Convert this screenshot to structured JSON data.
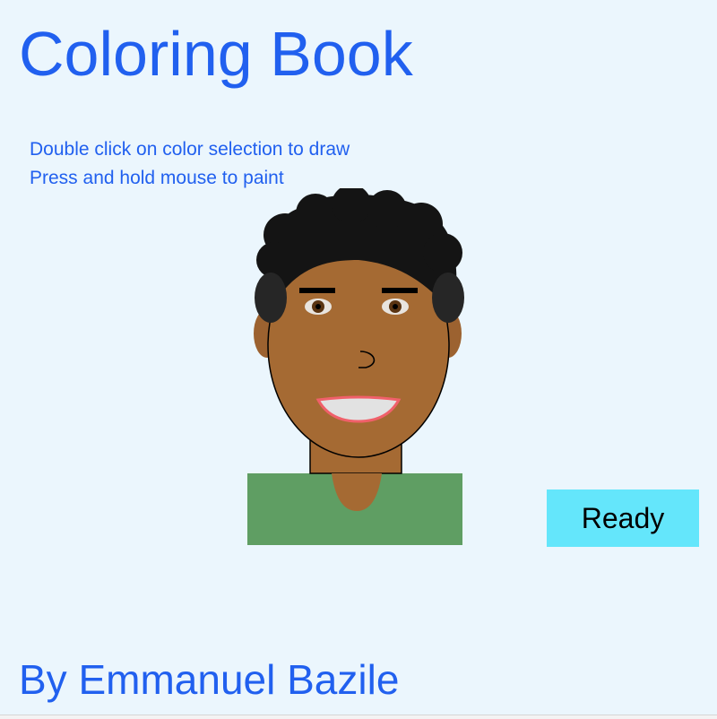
{
  "title": "Coloring Book",
  "instructions": {
    "line1": "Double click on color selection to draw",
    "line2": "Press and hold mouse to paint"
  },
  "ready_button": {
    "label": "Ready"
  },
  "author": "By Emmanuel Bazile",
  "colors": {
    "background": "#ebf6fd",
    "text_accent": "#2160ef",
    "ready_button": "#64e6fb",
    "skin": "#a56a33",
    "hair": "#141414",
    "shirt": "#5f9e63",
    "lips": "#f0606a",
    "teeth": "#e2e2e2"
  }
}
